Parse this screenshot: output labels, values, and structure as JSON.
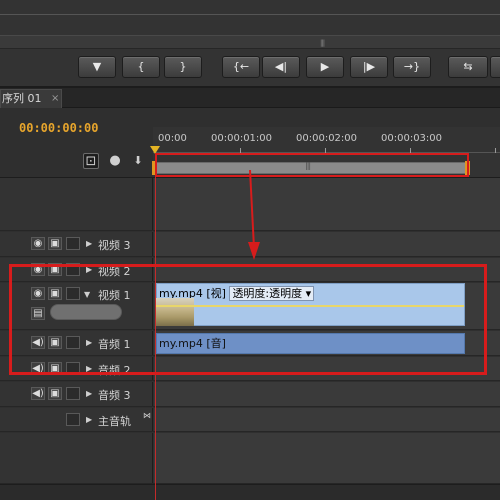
{
  "transport": {
    "buttons": [
      "▼",
      "{",
      "}",
      "{←",
      "◀|",
      "▶",
      "|▶",
      "→}",
      "⇆"
    ]
  },
  "sequence": {
    "tab_label": "序列 01",
    "close_label": "×",
    "timecode": "00:00:00:00"
  },
  "ruler": {
    "ticks": [
      "00:00",
      "00:00:01:00",
      "00:00:02:00",
      "00:00:03:00"
    ]
  },
  "tracks": {
    "video3": "视频 3",
    "video2": "视频 2",
    "video1": "视频 1",
    "audio1": "音频 1",
    "audio2": "音频 2",
    "audio3": "音频 3",
    "master": "主音轨"
  },
  "clips": {
    "video_name": "my.mp4 [视]",
    "video_effect": "透明度:透明度",
    "audio_name": "my.mp4 [音]"
  },
  "colors": {
    "timecode": "#e7a52c",
    "video_clip": "#a9c7ea",
    "audio_clip": "#6e90c6",
    "annotation": "#d71c1c",
    "playhead": "#c42b2b"
  },
  "icons": {
    "snap": "snap-icon",
    "marker": "marker-icon",
    "eye": "eye-icon",
    "speaker": "speaker-icon",
    "film": "film-icon"
  }
}
